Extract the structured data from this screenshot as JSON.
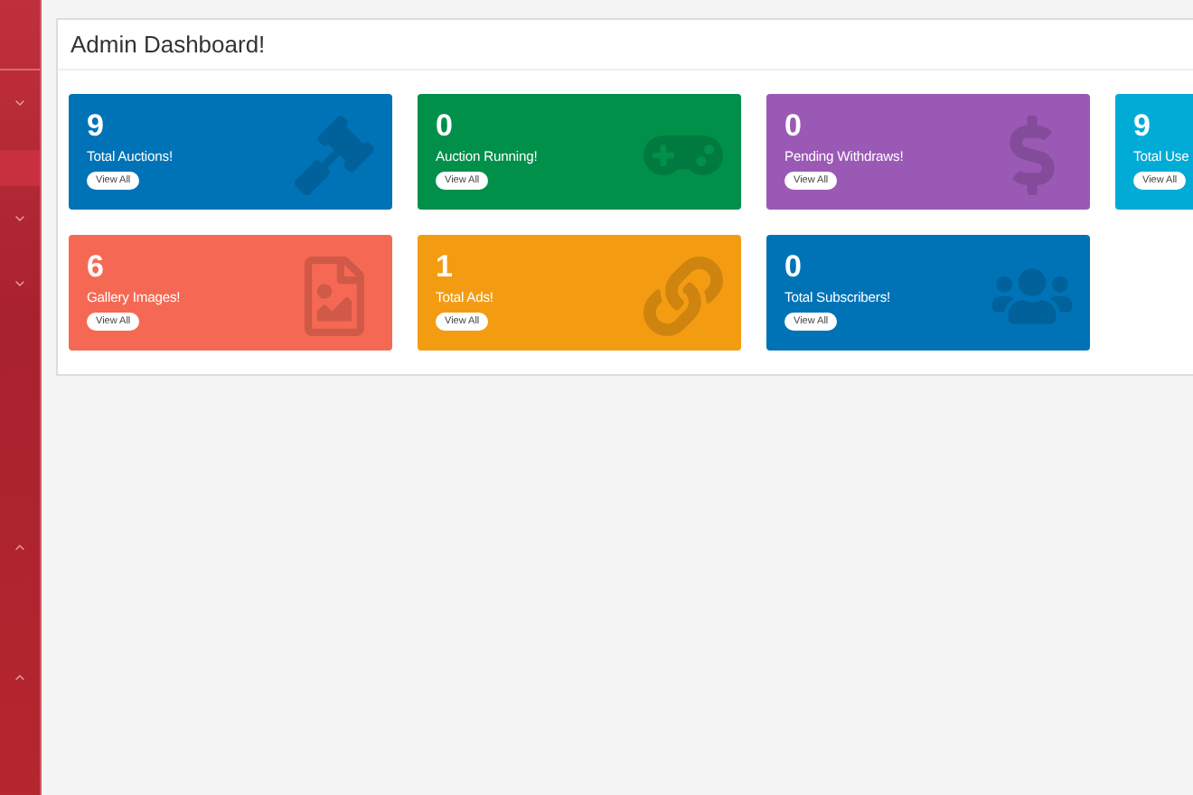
{
  "sidebar": {
    "items": [
      {
        "kind": "toggle",
        "expanded": false,
        "selected": false
      },
      {
        "kind": "link",
        "selected": true
      },
      {
        "kind": "toggle",
        "expanded": false,
        "selected": false
      },
      {
        "kind": "toggle",
        "expanded": false,
        "selected": false
      },
      {
        "kind": "toggle",
        "expanded": true,
        "selected": false
      },
      {
        "kind": "toggle",
        "expanded": true,
        "selected": false
      }
    ]
  },
  "panel": {
    "title": "Admin Dashboard!",
    "cards": [
      {
        "count": "9",
        "label": "Total Auctions!",
        "button": "View All",
        "color": "#0073b7"
      },
      {
        "count": "0",
        "label": "Auction Running!",
        "button": "View All",
        "color": "#00904a"
      },
      {
        "count": "0",
        "label": "Pending Withdraws!",
        "button": "View All",
        "color": "#9b59b6"
      },
      {
        "count": "9",
        "label": "Total Use",
        "button": "View All",
        "color": "#00acd6"
      },
      {
        "count": "6",
        "label": "Gallery Images!",
        "button": "View All",
        "color": "#f56954"
      },
      {
        "count": "1",
        "label": "Total Ads!",
        "button": "View All",
        "color": "#f39c12"
      },
      {
        "count": "0",
        "label": "Total Subscribers!",
        "button": "View All",
        "color": "#0073b7"
      }
    ]
  }
}
